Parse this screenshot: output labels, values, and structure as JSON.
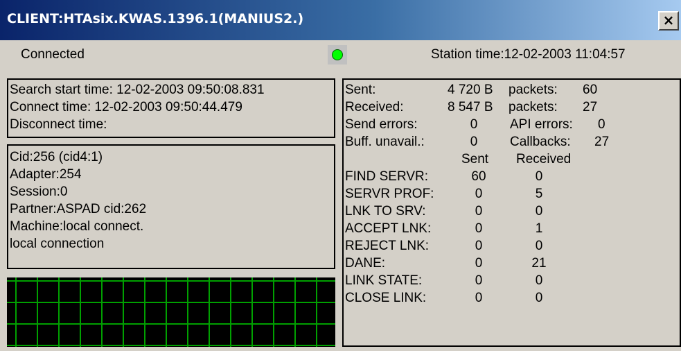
{
  "window": {
    "title": "CLIENT:HTAsix.KWAS.1396.1(MANIUS2.)",
    "close_label": "×"
  },
  "status": {
    "connection": "Connected",
    "indicator_color": "#00ff00",
    "station_time": "Station time:12-02-2003 11:04:57"
  },
  "times": {
    "search_start": "Search start time: 12-02-2003 09:50:08.831",
    "connect": "Connect time: 12-02-2003 09:50:44.479",
    "disconnect": "Disconnect time:"
  },
  "info": {
    "cid": "Cid:256 (cid4:1)",
    "adapter": "Adapter:254",
    "session": "Session:0",
    "partner": "Partner:ASPAD cid:262",
    "machine": "Machine:local connect.",
    "connection": "local connection"
  },
  "stats": {
    "sent_label": "Sent:",
    "sent_bytes": "4 720 B",
    "sent_packets_label": "packets:",
    "sent_packets": "60",
    "received_label": "Received:",
    "received_bytes": "8 547 B",
    "received_packets_label": "packets:",
    "received_packets": "27",
    "send_errors_label": "Send errors:",
    "send_errors": "0",
    "api_errors_label": "API errors:",
    "api_errors": "0",
    "buff_unavail_label": "Buff. unavail.:",
    "buff_unavail": "0",
    "callbacks_label": "Callbacks:",
    "callbacks": "27",
    "col_sent": "Sent",
    "col_received": "Received",
    "rows": [
      {
        "label": "FIND SERVR:",
        "sent": "60",
        "received": "0"
      },
      {
        "label": "SERVR PROF:",
        "sent": "0",
        "received": "5"
      },
      {
        "label": "LNK TO SRV:",
        "sent": "0",
        "received": "0"
      },
      {
        "label": "ACCEPT LNK:",
        "sent": "0",
        "received": "1"
      },
      {
        "label": "REJECT LNK:",
        "sent": "0",
        "received": "0"
      },
      {
        "label": "DANE:",
        "sent": "0",
        "received": "21"
      },
      {
        "label": "LINK STATE:",
        "sent": "0",
        "received": "0"
      },
      {
        "label": "CLOSE LINK:",
        "sent": "0",
        "received": "0"
      }
    ]
  }
}
